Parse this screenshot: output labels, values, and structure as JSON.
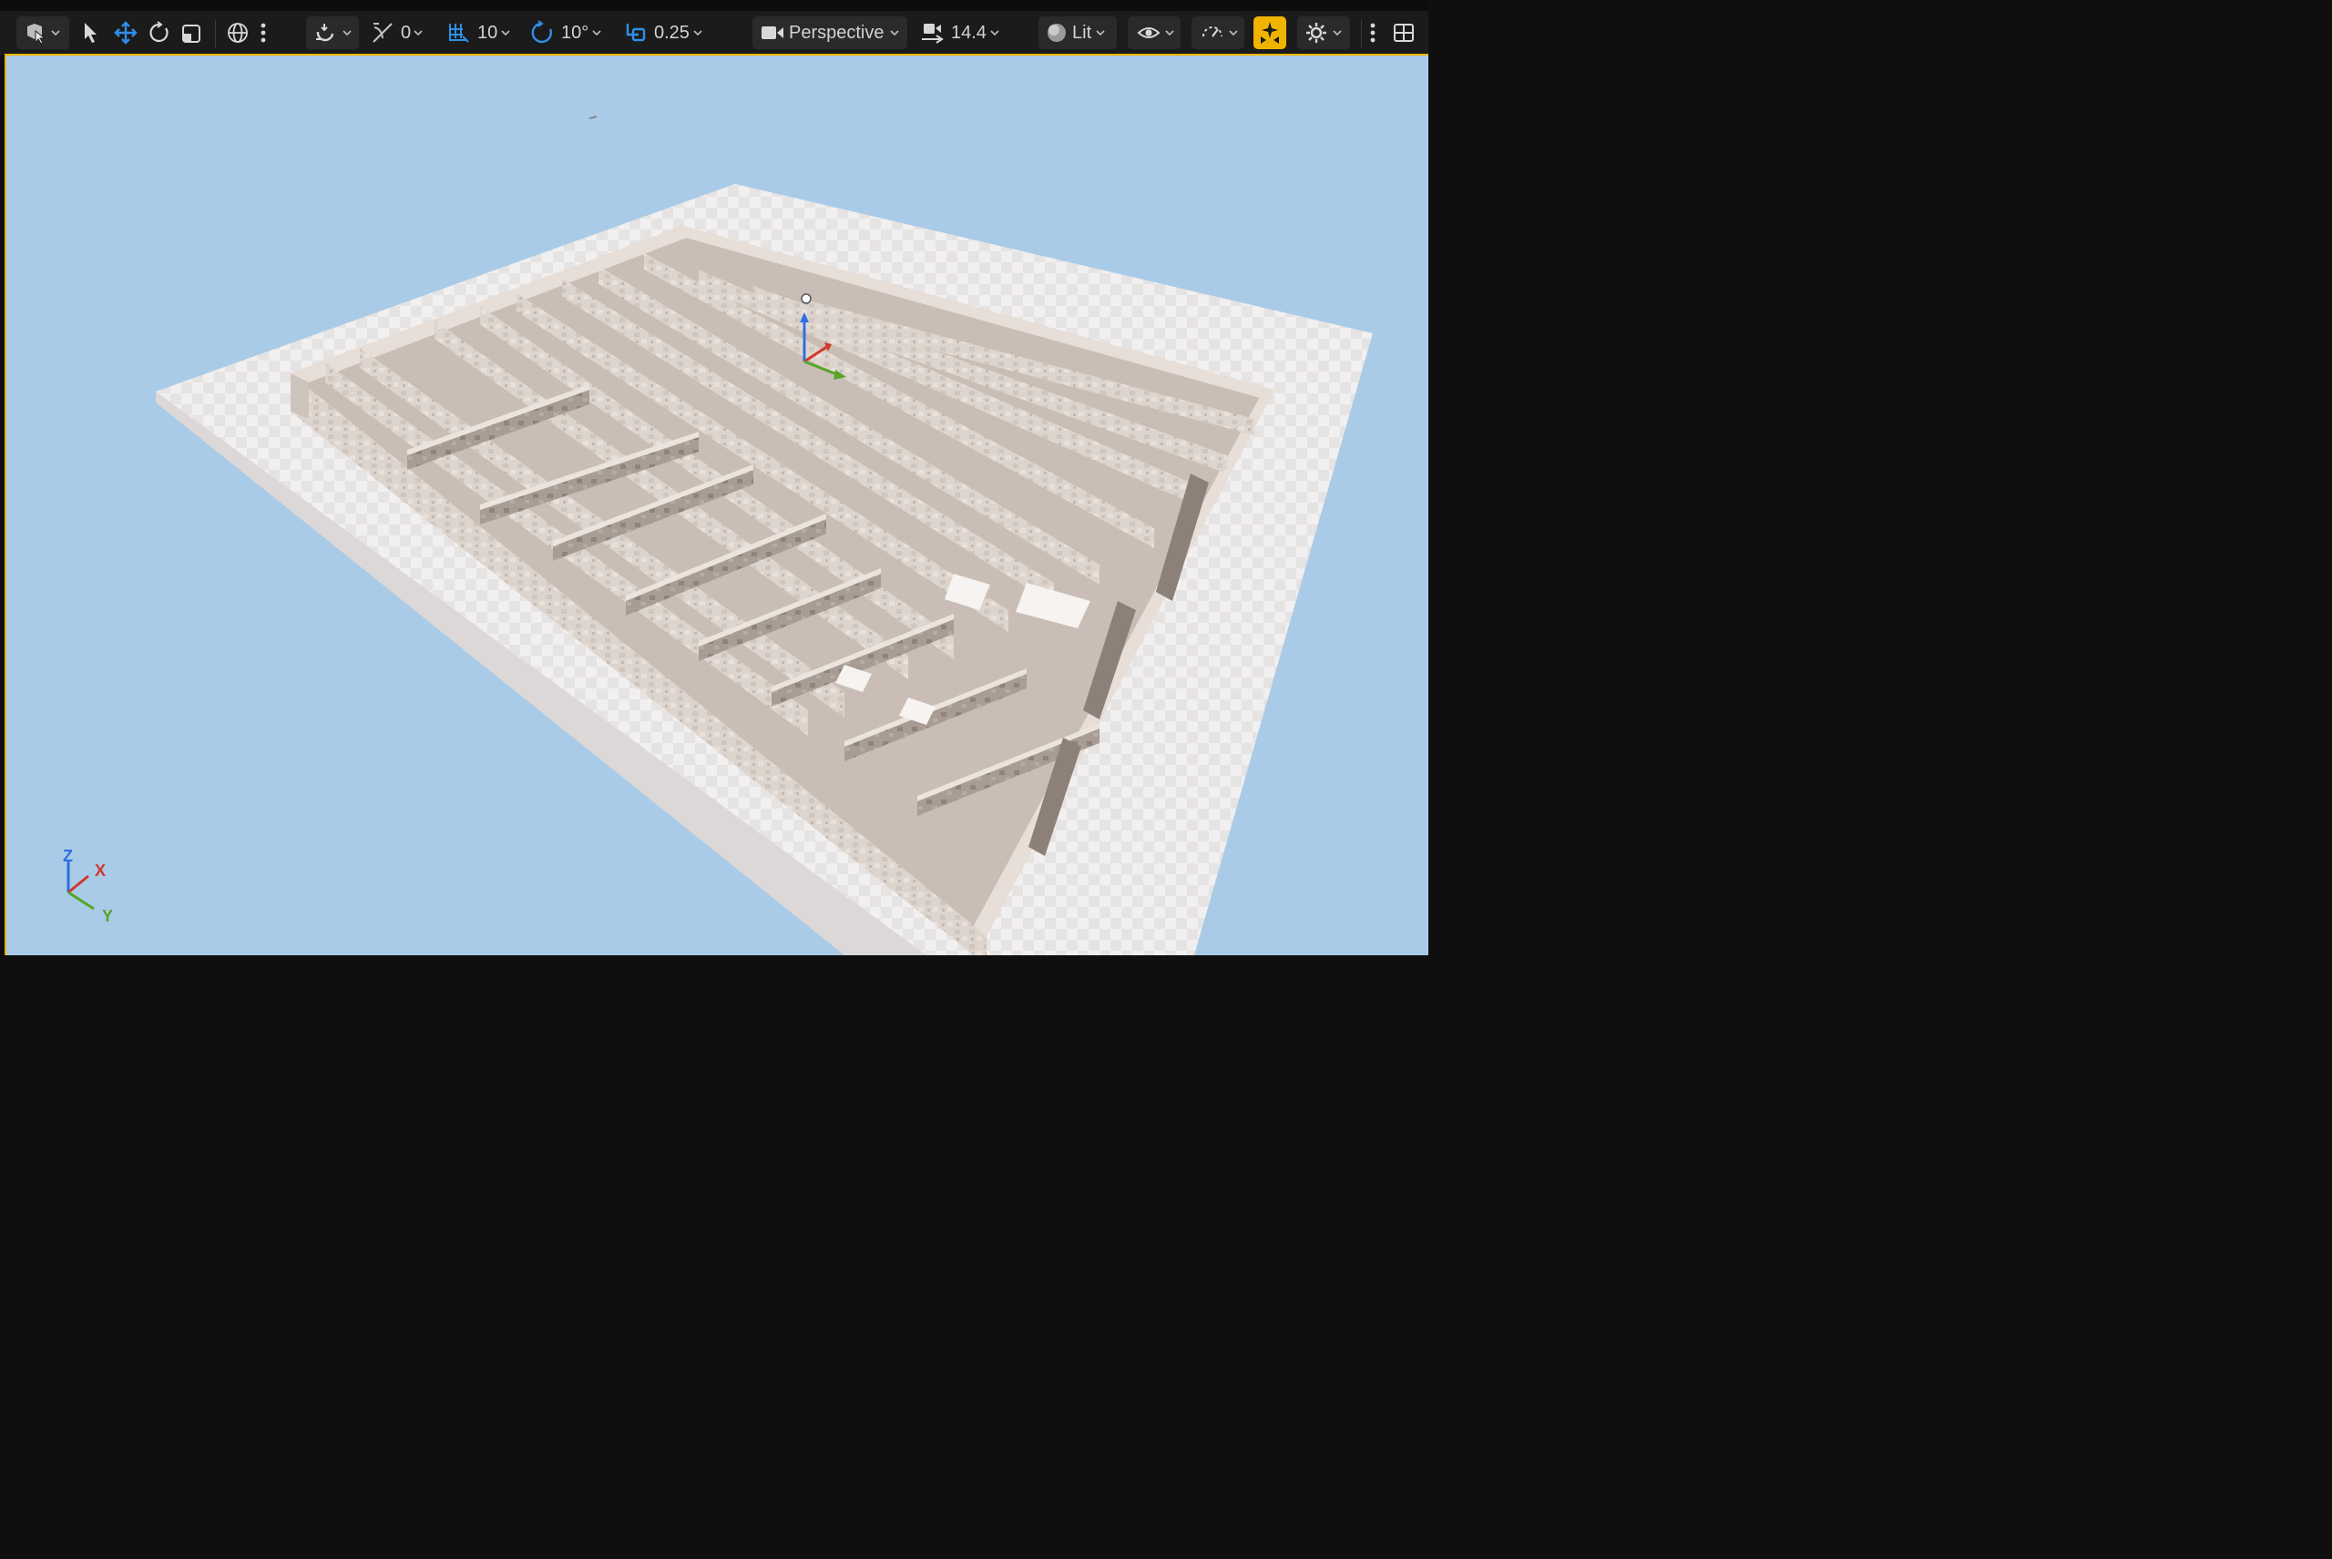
{
  "toolbar": {
    "select_mode_icon": "select-mode-icon",
    "tools": [
      "select-arrow-icon",
      "translate-icon",
      "rotate-icon",
      "scale-icon"
    ],
    "coord_space_icon": "world-globe-icon",
    "snapping_icon": "surface-snap-icon",
    "angle_value": "0",
    "grid_snap_value": "10",
    "rotation_snap_value": "10°",
    "scale_snap_value": "0.25",
    "view_mode_label": "Perspective",
    "camera_speed_value": "14.4",
    "lighting_mode_label": "Lit",
    "show_icon": "eye-icon",
    "realtime_icon": "realtime-icon",
    "game_view_icon": "game-view-icon",
    "settings_icon": "gear-icon",
    "more_icon": "more-vertical-icon",
    "layout_icon": "viewport-layout-icon"
  },
  "axis_gizmo": {
    "z": "Z",
    "x": "X",
    "y": "Y"
  },
  "colors": {
    "accent": "#f0b400",
    "sky": "#a9cbe7",
    "toolbar_bg": "#1b1b1b",
    "wall": "#ddd4cd",
    "floor": "#eeebeb",
    "axis_x": "#d0392b",
    "axis_y": "#58a42b",
    "axis_z": "#2f6fe0",
    "active_blue": "#2f8fe8"
  }
}
